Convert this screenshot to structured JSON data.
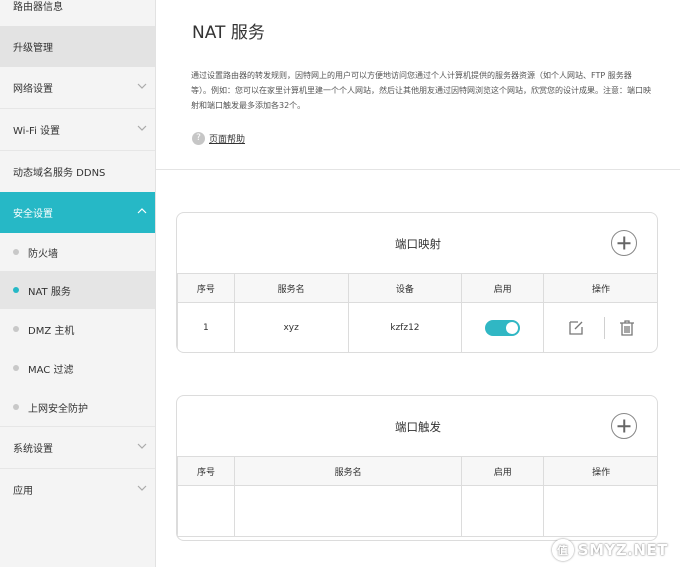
{
  "sidebar": {
    "items": [
      {
        "label": "路由器信息"
      },
      {
        "label": "升级管理"
      },
      {
        "label": "网络设置"
      },
      {
        "label": "Wi-Fi 设置"
      },
      {
        "label": "动态域名服务 DDNS"
      },
      {
        "label": "安全设置"
      },
      {
        "label": "系统设置"
      },
      {
        "label": "应用"
      }
    ],
    "sub_items": [
      {
        "label": "防火墙"
      },
      {
        "label": "NAT 服务"
      },
      {
        "label": "DMZ 主机"
      },
      {
        "label": "MAC 过滤"
      },
      {
        "label": "上网安全防护"
      }
    ]
  },
  "main": {
    "title": "NAT 服务",
    "description": "通过设置路由器的转发规则，因特网上的用户可以方便地访问您通过个人计算机提供的服务器资源（如个人网站、FTP 服务器等）。例如：您可以在家里计算机里建一个个人网站，然后让其他朋友通过因特网浏览这个网站，欣赏您的设计成果。注意：端口映射和端口触发最多添加各32个。",
    "help_label": "页面帮助",
    "help_icon": "?"
  },
  "port_mapping": {
    "title": "端口映射",
    "columns": [
      "序号",
      "服务名",
      "设备",
      "启用",
      "操作"
    ],
    "rows": [
      {
        "index": "1",
        "service": "xyz",
        "device": "kzfz12",
        "enabled": true
      }
    ]
  },
  "port_trigger": {
    "title": "端口触发",
    "columns": [
      "序号",
      "服务名",
      "启用",
      "操作"
    ]
  },
  "watermark": {
    "text": "SMYZ.NET",
    "icon_glyph": "值"
  },
  "colors": {
    "accent": "#26b8c6",
    "toggle_on": "#30b7c4"
  }
}
